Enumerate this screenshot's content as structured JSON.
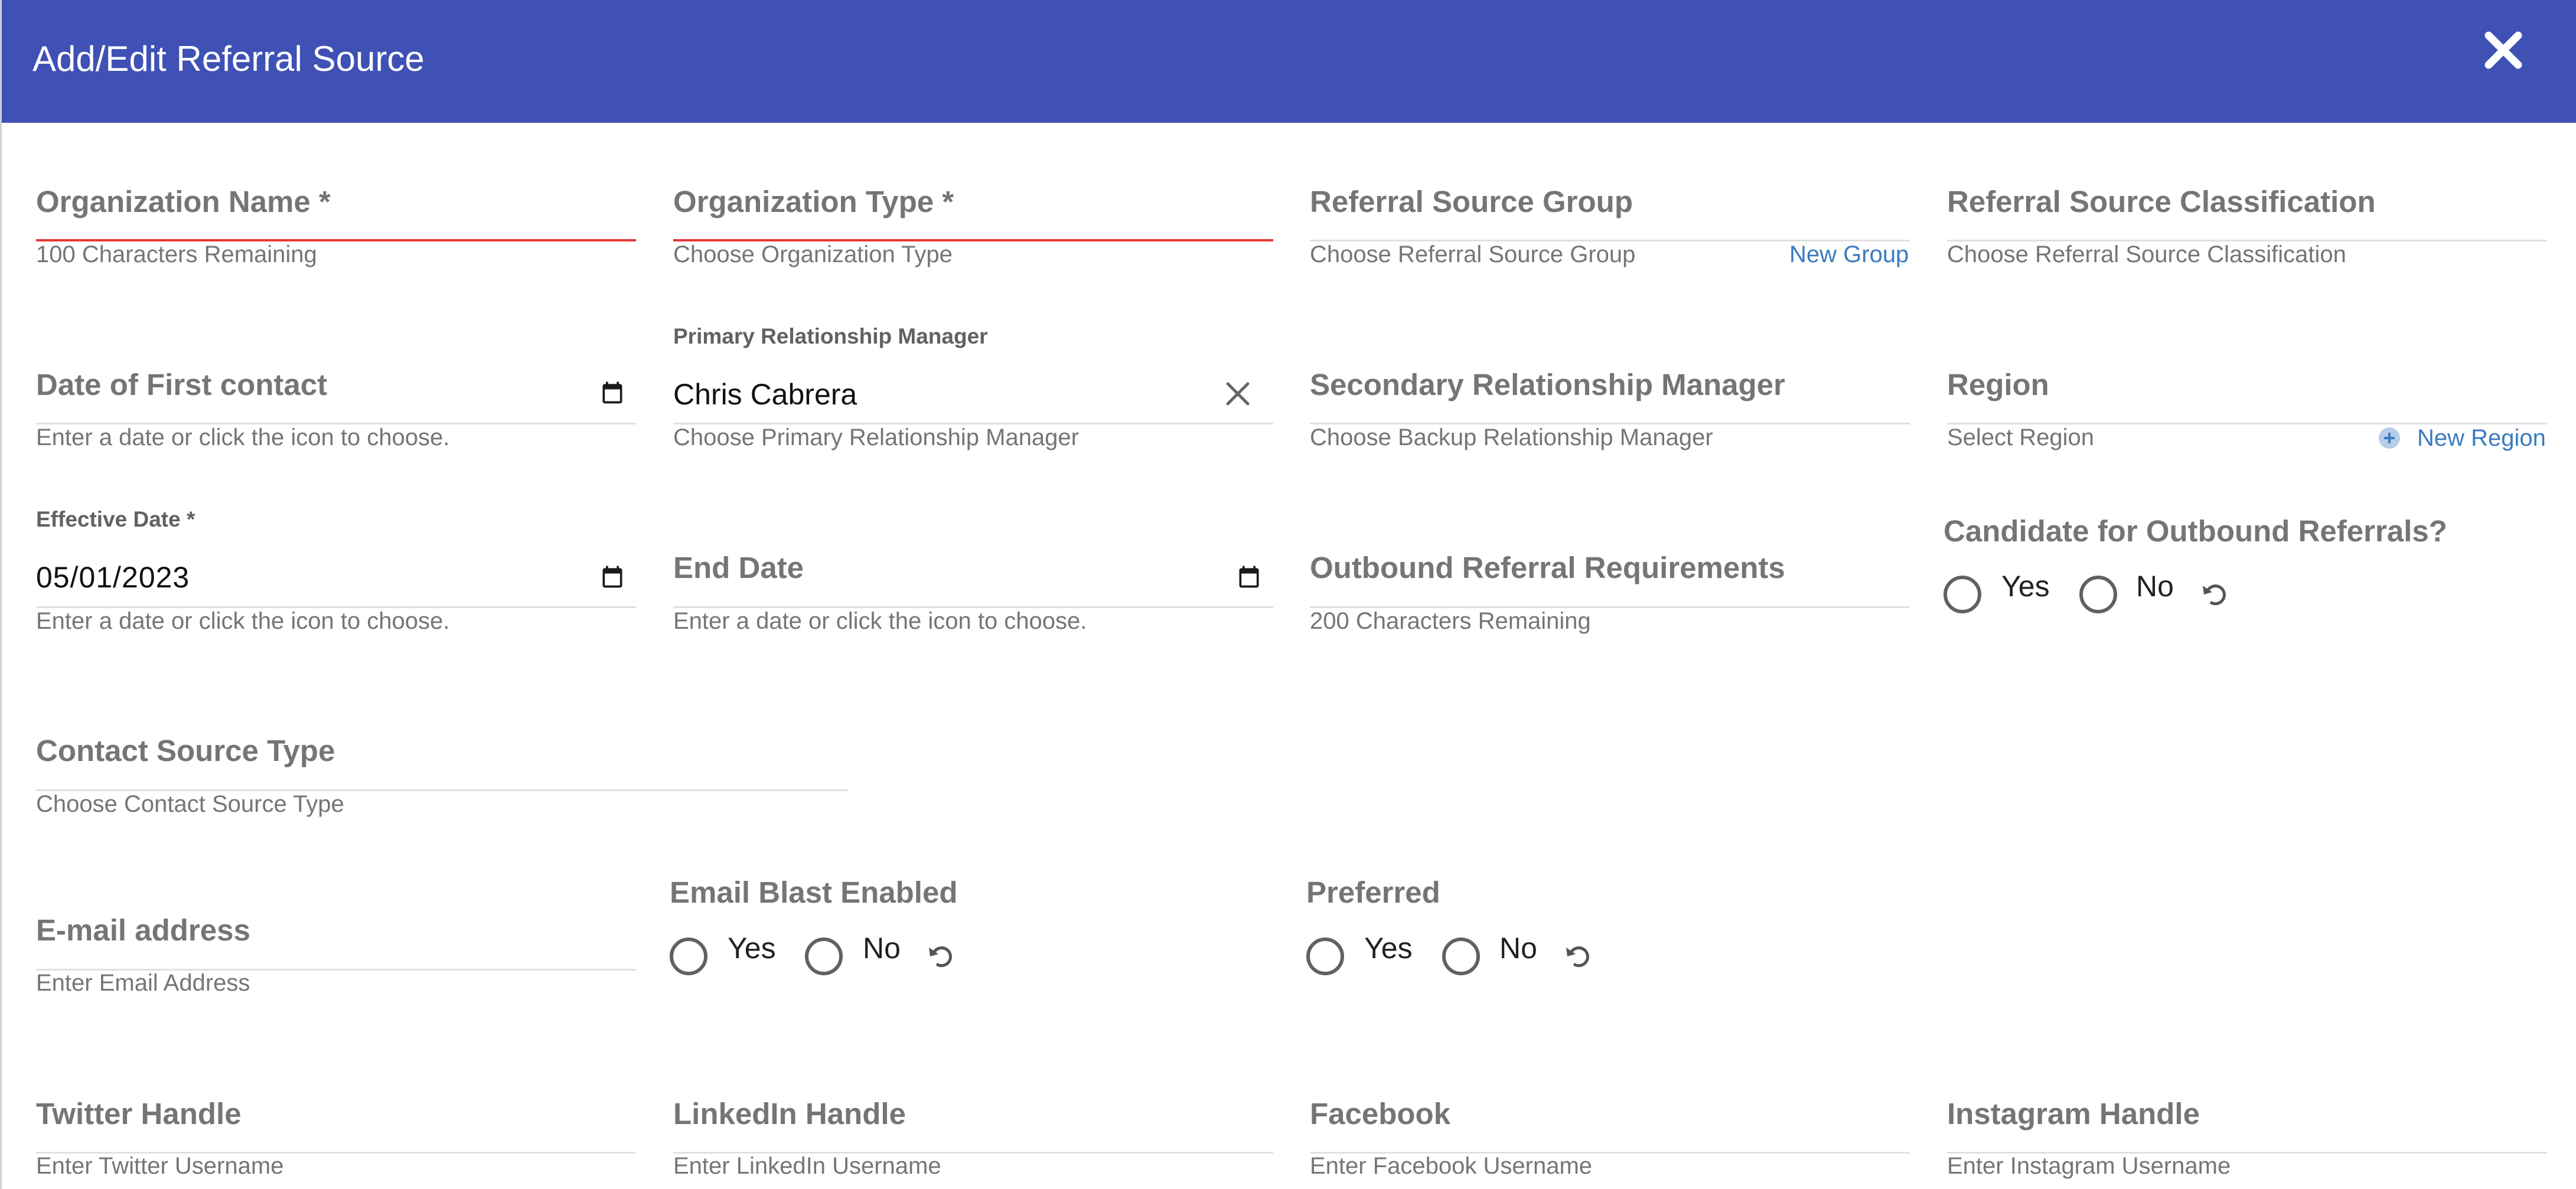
{
  "header": {
    "title": "Add/Edit Referral Source"
  },
  "colors": {
    "header_bg": "#3f51b5",
    "error_underline": "#e53935",
    "link": "#3a7bbf",
    "label": "#757575"
  },
  "fields": {
    "organization_name": {
      "label": "Organization Name *",
      "helper": "100 Characters Remaining"
    },
    "organization_type": {
      "label": "Organization Type *",
      "helper": "Choose Organization Type"
    },
    "referral_source_group": {
      "label": "Referral Source Group",
      "helper": "Choose Referral Source Group",
      "link": "New Group"
    },
    "referral_source_classification": {
      "label": "Referral Source Classification",
      "helper": "Choose Referral Source Classification"
    },
    "date_first_contact": {
      "label": "Date of First contact",
      "helper": "Enter a date or click the icon to choose."
    },
    "primary_relationship_manager": {
      "label": "Primary Relationship Manager",
      "value": "Chris Cabrera",
      "helper": "Choose Primary Relationship Manager"
    },
    "secondary_relationship_manager": {
      "label": "Secondary Relationship Manager",
      "helper": "Choose Backup Relationship Manager"
    },
    "region": {
      "label": "Region",
      "helper": "Select Region",
      "link": "New Region"
    },
    "effective_date": {
      "label": "Effective Date *",
      "value": "05/01/2023",
      "helper": "Enter a date or click the icon to choose."
    },
    "end_date": {
      "label": "End Date",
      "helper": "Enter a date or click the icon to choose."
    },
    "outbound_referral_requirements": {
      "label": "Outbound Referral Requirements",
      "helper": "200 Characters Remaining"
    },
    "candidate_outbound": {
      "label": "Candidate for Outbound Referrals?",
      "yes": "Yes",
      "no": "No"
    },
    "contact_source_type": {
      "label": "Contact Source Type",
      "helper": "Choose Contact Source Type"
    },
    "email": {
      "label": "E-mail address",
      "helper": "Enter Email Address"
    },
    "email_blast": {
      "label": "Email Blast Enabled",
      "yes": "Yes",
      "no": "No"
    },
    "preferred": {
      "label": "Preferred",
      "yes": "Yes",
      "no": "No"
    },
    "twitter": {
      "label": "Twitter Handle",
      "helper": "Enter Twitter Username"
    },
    "linkedin": {
      "label": "LinkedIn Handle",
      "helper": "Enter LinkedIn Username"
    },
    "facebook": {
      "label": "Facebook",
      "helper": "Enter Facebook Username"
    },
    "instagram": {
      "label": "Instagram Handle",
      "helper": "Enter Instagram Username"
    }
  }
}
